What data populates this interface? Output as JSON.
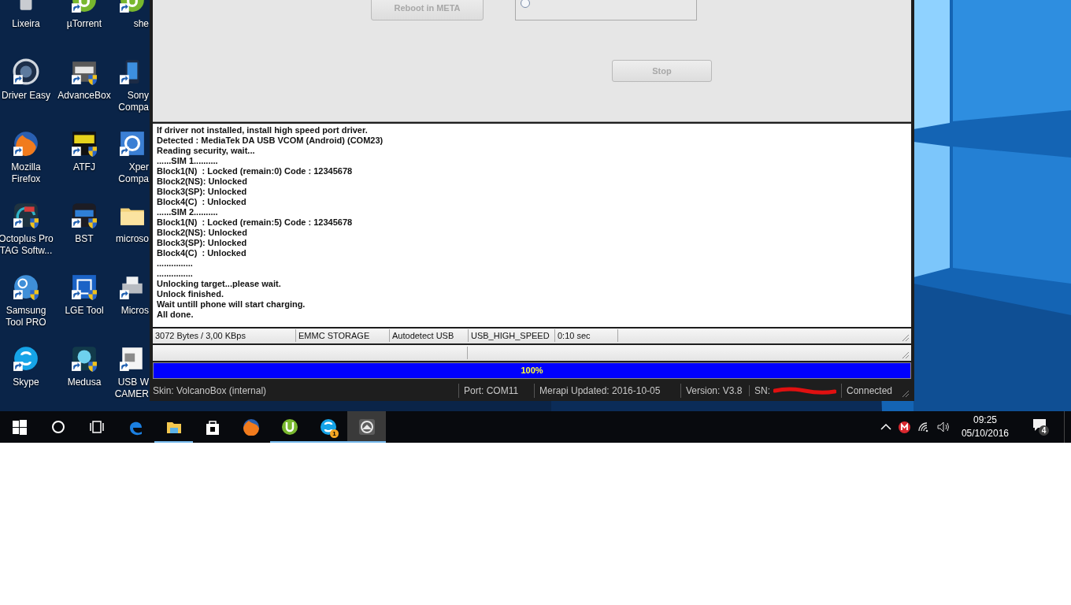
{
  "desktop_icons": [
    {
      "label": "Lixeira",
      "kind": "bin",
      "shortcut": false,
      "shield": false
    },
    {
      "label": "Driver Easy",
      "kind": "ring",
      "shortcut": true,
      "shield": false
    },
    {
      "label": "Mozilla\nFirefox",
      "kind": "fox",
      "shortcut": true,
      "shield": false
    },
    {
      "label": "Octoplus Pro\nTAG Softw...",
      "kind": "octo",
      "shortcut": true,
      "shield": true
    },
    {
      "label": "Samsung\nTool PRO",
      "kind": "gearball",
      "shortcut": true,
      "shield": true
    },
    {
      "label": "Skype",
      "kind": "skype",
      "shortcut": true,
      "shield": false
    },
    {
      "label": "µTorrent",
      "kind": "torrent",
      "shortcut": true,
      "shield": false
    },
    {
      "label": "AdvanceBox",
      "kind": "box",
      "shortcut": true,
      "shield": true
    },
    {
      "label": "ATFJ",
      "kind": "atf",
      "shortcut": true,
      "shield": true
    },
    {
      "label": "BST",
      "kind": "bst",
      "shortcut": true,
      "shield": true
    },
    {
      "label": "LGE Tool",
      "kind": "lge",
      "shortcut": true,
      "shield": true
    },
    {
      "label": "Medusa",
      "kind": "medusa",
      "shortcut": true,
      "shield": true
    },
    {
      "label": "she",
      "kind": "torrent",
      "shortcut": true,
      "shield": false
    },
    {
      "label": "Sony\nCompa",
      "kind": "phone",
      "shortcut": true,
      "shield": false
    },
    {
      "label": "Xper\nCompa",
      "kind": "xperia",
      "shortcut": true,
      "shield": false
    },
    {
      "label": "microso",
      "kind": "folder",
      "shortcut": false,
      "shield": false
    },
    {
      "label": "Micros",
      "kind": "printer",
      "shortcut": true,
      "shield": false
    },
    {
      "label": "USB W\nCAMER",
      "kind": "doc",
      "shortcut": true,
      "shield": false
    }
  ],
  "window": {
    "buttons": [
      {
        "label": "Reboot in META",
        "disabled": true
      },
      {
        "label": "Stop",
        "disabled": true
      }
    ],
    "mode_radio": {
      "selected": false
    },
    "log": [
      "If driver not installed, install high speed port driver.",
      "Detected : MediaTek DA USB VCOM (Android) (COM23)",
      "Reading security, wait...",
      "......SIM 1..........",
      "Block1(N)  : Locked (remain:0) Code : 12345678",
      "Block2(NS): Unlocked",
      "Block3(SP): Unlocked",
      "Block4(C)  : Unlocked",
      "......SIM 2..........",
      "Block1(N)  : Locked (remain:5) Code : 12345678",
      "Block2(NS): Unlocked",
      "Block3(SP): Unlocked",
      "Block4(C)  : Unlocked",
      "...............",
      "...............",
      "Unlocking target...please wait.",
      "Unlock finished.",
      "Wait untill phone will start charging.",
      "All done."
    ],
    "status_bar": [
      "3072 Bytes / 3,00 KBps",
      "EMMC STORAGE",
      "Autodetect USB",
      "USB_HIGH_SPEED",
      "0:10 sec"
    ],
    "progress": {
      "level": 1,
      "label": "100%"
    },
    "info_bar": {
      "skin": "Skin: VolcanoBox (internal)",
      "port": "Port: COM11",
      "updated": "Merapi Updated: 2016-10-05",
      "version": "Version: V3.8",
      "sn": "SN:",
      "connection": "Connected"
    }
  },
  "taskbar": {
    "items": [
      {
        "kind": "start",
        "active": false,
        "selected": false
      },
      {
        "kind": "search",
        "active": false,
        "selected": false
      },
      {
        "kind": "taskview",
        "active": false,
        "selected": false
      },
      {
        "kind": "edge",
        "active": false,
        "selected": false
      },
      {
        "kind": "explorer",
        "active": true,
        "selected": false
      },
      {
        "kind": "store",
        "active": false,
        "selected": false
      },
      {
        "kind": "fox",
        "active": false,
        "selected": false
      },
      {
        "kind": "torrent",
        "active": true,
        "selected": false
      },
      {
        "kind": "skype",
        "active": true,
        "selected": false,
        "badge": "1"
      },
      {
        "kind": "volcano",
        "active": true,
        "selected": true
      }
    ],
    "tray": {
      "time": "09:25",
      "date": "05/10/2016",
      "notifications": "4"
    }
  }
}
